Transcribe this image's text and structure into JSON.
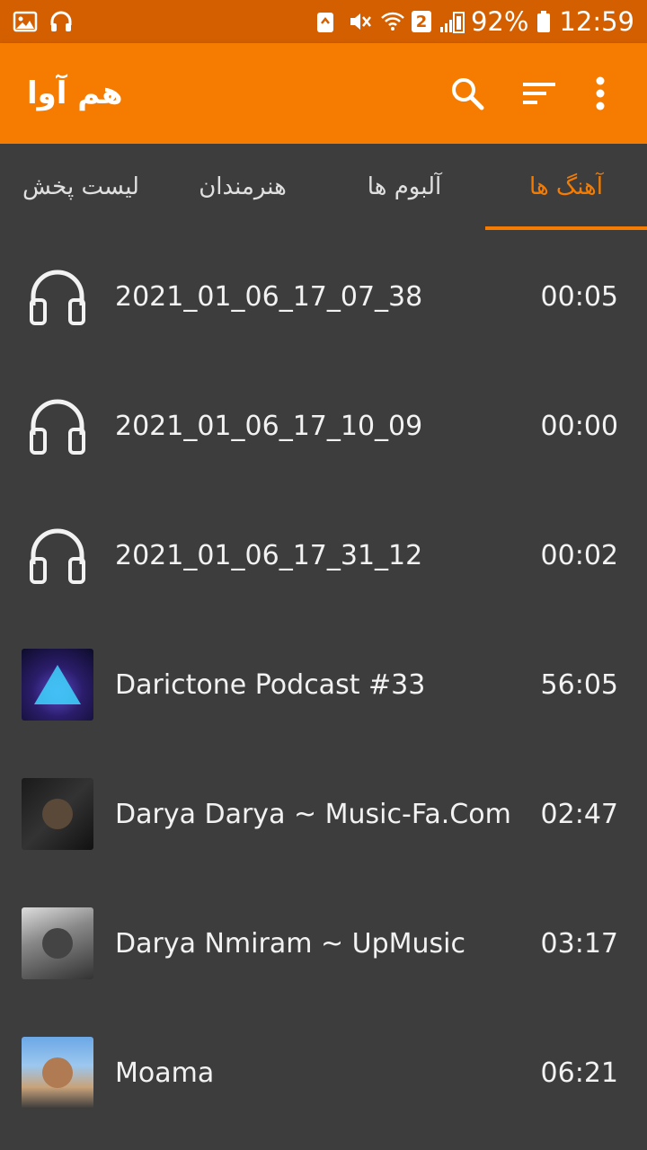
{
  "status_bar": {
    "battery": "92%",
    "time": "12:59",
    "sim_slot": "2",
    "left_icons": [
      "image-icon",
      "headphones-icon"
    ],
    "right_icons": [
      "recycle-icon",
      "mute-icon",
      "wifi-icon",
      "signal-icon",
      "battery-icon"
    ]
  },
  "app_bar": {
    "title": "هم آوا",
    "actions": [
      "search-icon",
      "sort-icon",
      "more-vert-icon"
    ]
  },
  "tabs": [
    {
      "label": "لیست پخش"
    },
    {
      "label": "هنرمندان"
    },
    {
      "label": "آلبوم ها"
    },
    {
      "label": "آهنگ ها",
      "active": true
    }
  ],
  "songs": [
    {
      "title": "2021_01_06_17_07_38",
      "duration": "00:05",
      "thumb": "headphones-icon"
    },
    {
      "title": "2021_01_06_17_10_09",
      "duration": "00:00",
      "thumb": "headphones-icon"
    },
    {
      "title": "2021_01_06_17_31_12",
      "duration": "00:02",
      "thumb": "headphones-icon"
    },
    {
      "title": "Darictone Podcast #33",
      "duration": "56:05",
      "thumb": "album-art"
    },
    {
      "title": "Darya Darya ~ Music-Fa.Com",
      "duration": "02:47",
      "thumb": "album-art"
    },
    {
      "title": "Darya Nmiram ~ UpMusic",
      "duration": "03:17",
      "thumb": "album-art"
    },
    {
      "title": "Moama",
      "duration": "06:21",
      "thumb": "album-art"
    }
  ],
  "colors": {
    "status_bar": "#d35f00",
    "app_bar": "#f57c00",
    "accent": "#f57c00",
    "background": "#3d3d3d"
  }
}
